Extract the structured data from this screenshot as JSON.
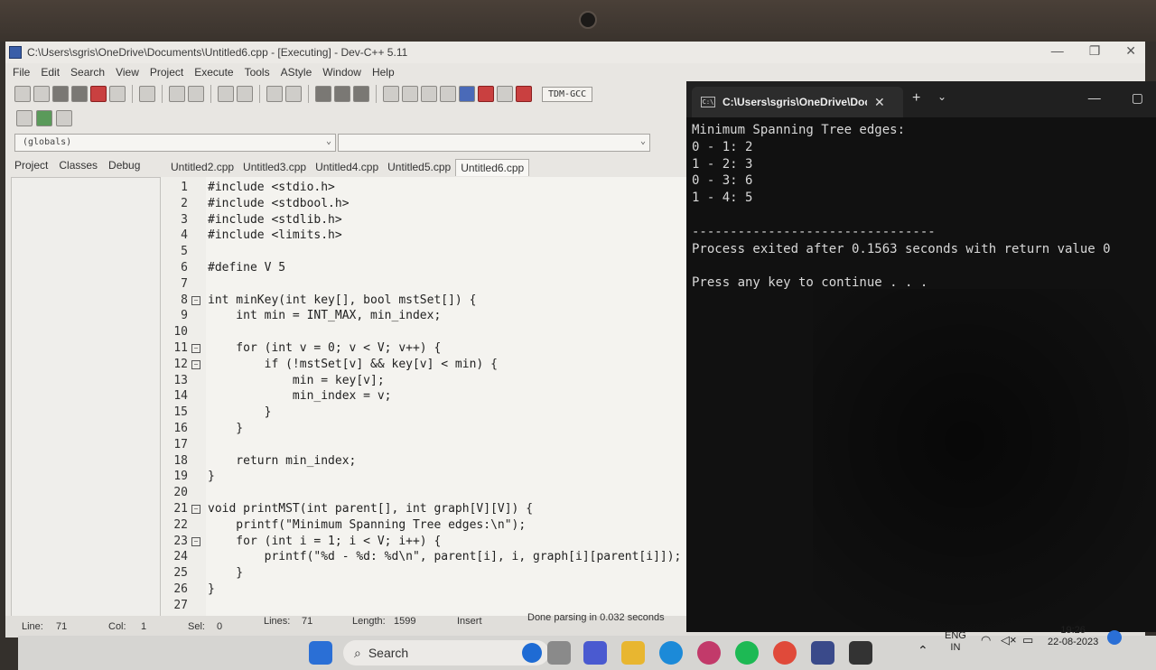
{
  "window": {
    "title": "C:\\Users\\sgris\\OneDrive\\Documents\\Untitled6.cpp - [Executing] - Dev-C++ 5.11",
    "controls": [
      "—",
      "❐",
      "✕"
    ]
  },
  "menu": [
    "File",
    "Edit",
    "Search",
    "View",
    "Project",
    "Execute",
    "Tools",
    "AStyle",
    "Window",
    "Help"
  ],
  "toolbar": {
    "compiler": "TDM-GCC"
  },
  "combos": {
    "scope": "(globals)",
    "symbol": ""
  },
  "panel_tabs": [
    "Project",
    "Classes",
    "Debug"
  ],
  "file_tabs": [
    "Untitled2.cpp",
    "Untitled3.cpp",
    "Untitled4.cpp",
    "Untitled5.cpp",
    "Untitled6.cpp"
  ],
  "active_file_tab": "Untitled6.cpp",
  "editor": {
    "lines": [
      {
        "n": "1",
        "fold": "",
        "code": "#include <stdio.h>"
      },
      {
        "n": "2",
        "fold": "",
        "code": "#include <stdbool.h>"
      },
      {
        "n": "3",
        "fold": "",
        "code": "#include <stdlib.h>"
      },
      {
        "n": "4",
        "fold": "",
        "code": "#include <limits.h>"
      },
      {
        "n": "5",
        "fold": "",
        "code": ""
      },
      {
        "n": "6",
        "fold": "",
        "code": "#define V 5"
      },
      {
        "n": "7",
        "fold": "",
        "code": ""
      },
      {
        "n": "8",
        "fold": "⊟",
        "code": "int minKey(int key[], bool mstSet[]) {"
      },
      {
        "n": "9",
        "fold": "",
        "code": "    int min = INT_MAX, min_index;"
      },
      {
        "n": "10",
        "fold": "",
        "code": ""
      },
      {
        "n": "11",
        "fold": "⊟",
        "code": "    for (int v = 0; v < V; v++) {"
      },
      {
        "n": "12",
        "fold": "⊟",
        "code": "        if (!mstSet[v] && key[v] < min) {"
      },
      {
        "n": "13",
        "fold": "",
        "code": "            min = key[v];"
      },
      {
        "n": "14",
        "fold": "",
        "code": "            min_index = v;"
      },
      {
        "n": "15",
        "fold": "",
        "code": "        }"
      },
      {
        "n": "16",
        "fold": "",
        "code": "    }"
      },
      {
        "n": "17",
        "fold": "",
        "code": ""
      },
      {
        "n": "18",
        "fold": "",
        "code": "    return min_index;"
      },
      {
        "n": "19",
        "fold": "",
        "code": "}"
      },
      {
        "n": "20",
        "fold": "",
        "code": ""
      },
      {
        "n": "21",
        "fold": "⊟",
        "code": "void printMST(int parent[], int graph[V][V]) {"
      },
      {
        "n": "22",
        "fold": "",
        "code": "    printf(\"Minimum Spanning Tree edges:\\n\");"
      },
      {
        "n": "23",
        "fold": "⊟",
        "code": "    for (int i = 1; i < V; i++) {"
      },
      {
        "n": "24",
        "fold": "",
        "code": "        printf(\"%d - %d: %d\\n\", parent[i], i, graph[i][parent[i]]);"
      },
      {
        "n": "25",
        "fold": "",
        "code": "    }"
      },
      {
        "n": "26",
        "fold": "",
        "code": "}"
      },
      {
        "n": "27",
        "fold": "",
        "code": ""
      }
    ]
  },
  "status": {
    "line_label": "Line:",
    "line": "71",
    "col_label": "Col:",
    "col": "1",
    "sel_label": "Sel:",
    "sel": "0",
    "lines_label": "Lines:",
    "lines": "71",
    "length_label": "Length:",
    "length": "1599",
    "mode": "Insert",
    "message": "Done parsing in 0.032 seconds"
  },
  "console": {
    "tab_title": "C:\\Users\\sgris\\OneDrive\\Docu",
    "output": [
      "Minimum Spanning Tree edges:",
      "0 - 1: 2",
      "1 - 2: 3",
      "0 - 3: 6",
      "1 - 4: 5",
      "",
      "--------------------------------",
      "Process exited after 0.1563 seconds with return value 0",
      "",
      "Press any key to continue . . ."
    ]
  },
  "taskbar": {
    "search_label": "Search",
    "lang": "ENG",
    "region": "IN",
    "time": "19:26",
    "date": "22-08-2023"
  }
}
